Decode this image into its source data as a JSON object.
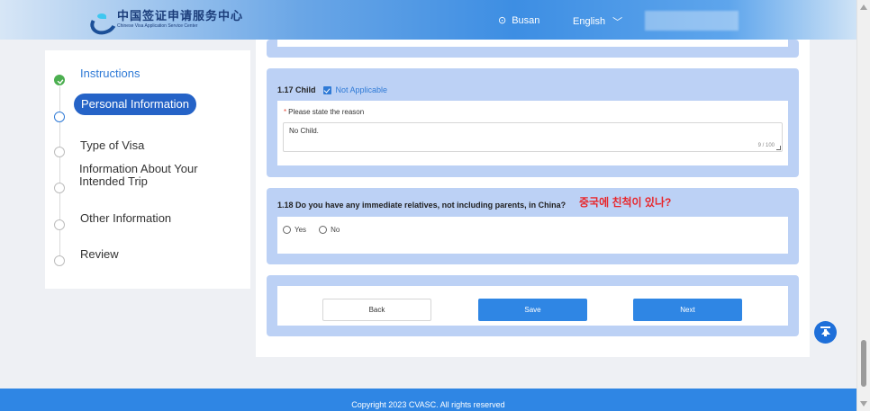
{
  "header": {
    "logo_cn": "中国签证申请服务中心",
    "logo_en": "Chinese Visa Application Service Center",
    "location": "Busan",
    "language": "English"
  },
  "sidebar": {
    "steps": [
      {
        "label": "Instructions",
        "state": "done"
      },
      {
        "label": "Personal Information",
        "state": "current"
      },
      {
        "label": "Type of Visa",
        "state": "pending"
      },
      {
        "label": "Information About Your Intended Trip",
        "state": "pending"
      },
      {
        "label": "Other Information",
        "state": "pending"
      },
      {
        "label": "Review",
        "state": "pending"
      }
    ]
  },
  "q117": {
    "title": "1.17 Child",
    "checkbox_label": "Not Applicable",
    "checked": true,
    "reason_label": "Please state the reason",
    "reason_value": "No Child.",
    "counter": "9 / 100"
  },
  "q118": {
    "title": "1.18 Do you have any immediate relatives, not including parents, in China?",
    "annotation": "중국에 친척이 있나?",
    "option_yes": "Yes",
    "option_no": "No"
  },
  "actions": {
    "back": "Back",
    "save": "Save",
    "next": "Next"
  },
  "footer": {
    "copyright": "Copyright 2023 CVASC. All rights reserved"
  },
  "colors": {
    "primary": "#2f86e4",
    "card_bg": "#bcd1f5",
    "annotation": "#e8262b"
  }
}
